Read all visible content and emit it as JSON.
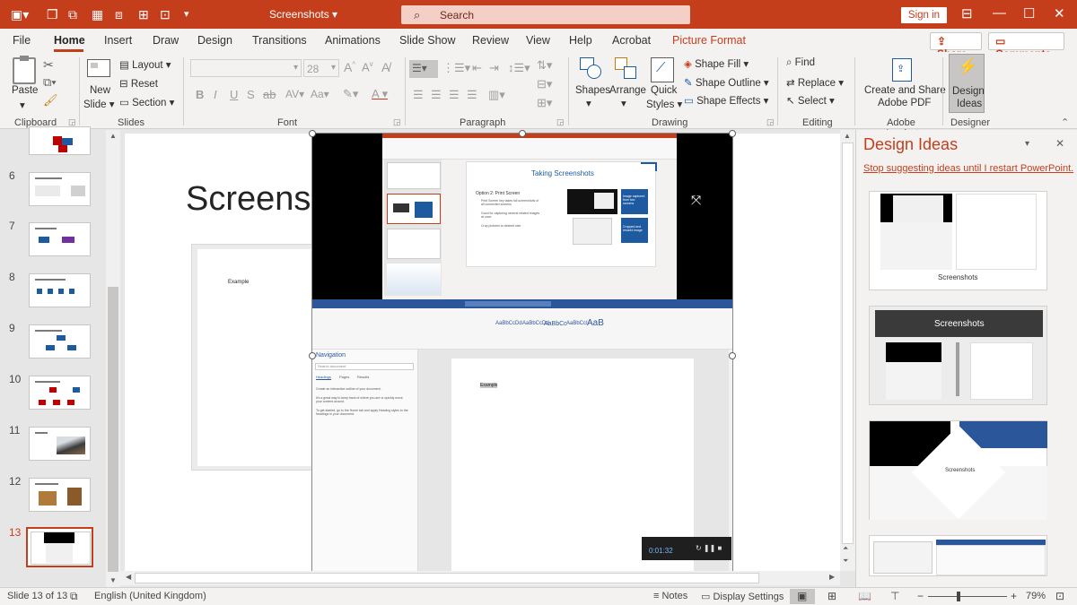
{
  "titlebar": {
    "title": "Screenshots",
    "title_caret": "▾",
    "search_placeholder": "Search",
    "signin": "Sign in"
  },
  "tabs": [
    "File",
    "Home",
    "Insert",
    "Draw",
    "Design",
    "Transitions",
    "Animations",
    "Slide Show",
    "Review",
    "View",
    "Help",
    "Acrobat",
    "Picture Format"
  ],
  "share": "Share",
  "comments": "Comments",
  "ribbon": {
    "clipboard": {
      "paste": "Paste",
      "group": "Clipboard"
    },
    "slides": {
      "new_slide_1": "New",
      "new_slide_2": "Slide",
      "layout": "Layout",
      "reset": "Reset",
      "section": "Section",
      "group": "Slides"
    },
    "font": {
      "size": "28",
      "group": "Font"
    },
    "paragraph": {
      "group": "Paragraph"
    },
    "drawing": {
      "shapes": "Shapes",
      "arrange": "Arrange",
      "quick_1": "Quick",
      "quick_2": "Styles",
      "fill": "Shape Fill",
      "outline": "Shape Outline",
      "effects": "Shape Effects",
      "group": "Drawing"
    },
    "editing": {
      "find": "Find",
      "replace": "Replace",
      "select": "Select",
      "group": "Editing"
    },
    "acrobat": {
      "create_1": "Create and Share",
      "create_2": "Adobe PDF",
      "group": "Adobe Acrobat"
    },
    "designer": {
      "ideas_1": "Design",
      "ideas_2": "Ideas",
      "group": "Designer"
    }
  },
  "slide_numbers": [
    "6",
    "7",
    "8",
    "9",
    "10",
    "11",
    "12",
    "13"
  ],
  "slide": {
    "title_partial": "Screensh",
    "inner_label": "Example"
  },
  "embedded": {
    "ppt_title": "Taking Screenshots",
    "ppt_bullet_head": "Option 2: Print Screen",
    "ppt_bullets": [
      "Print Screen key takes full screenshots of all connected screens",
      "Good for capturing several related images at once",
      "Crop pictures to desired size"
    ],
    "ppt_box1": "Image captured from two screens",
    "ppt_box2": "Cropped and resized image",
    "word_nav": "Navigation",
    "word_search": "Search document",
    "word_tabs": [
      "Headings",
      "Pages",
      "Results"
    ],
    "word_text1": "Create an interactive outline of your document.",
    "word_text2": "It's a great way to keep track of where you are or quickly move your content around.",
    "word_text3": "To get started, go to the Home tab and apply Heading styles to the headings in your document.",
    "word_example": "Example",
    "word_styles": [
      "AaBbCcDd",
      "AaBbCcDd",
      "AaBbCc",
      "AaBbCcI",
      "AaB"
    ],
    "recorder_time": "0:01:32"
  },
  "design_pane": {
    "title": "Design Ideas",
    "link": "Stop suggesting ideas until I restart PowerPoint.",
    "idea1_caption": "Screenshots",
    "idea2_banner": "Screenshots",
    "idea3_caption": "Screenshots"
  },
  "status": {
    "slide_of": "Slide 13 of 13",
    "language": "English (United Kingdom)",
    "notes": "Notes",
    "display": "Display Settings",
    "zoom": "79%",
    "zoom_percent": 79
  },
  "colors": {
    "accent": "#c43e1c",
    "blue": "#1e5aa0",
    "selected_slide": "#c43e1c"
  }
}
